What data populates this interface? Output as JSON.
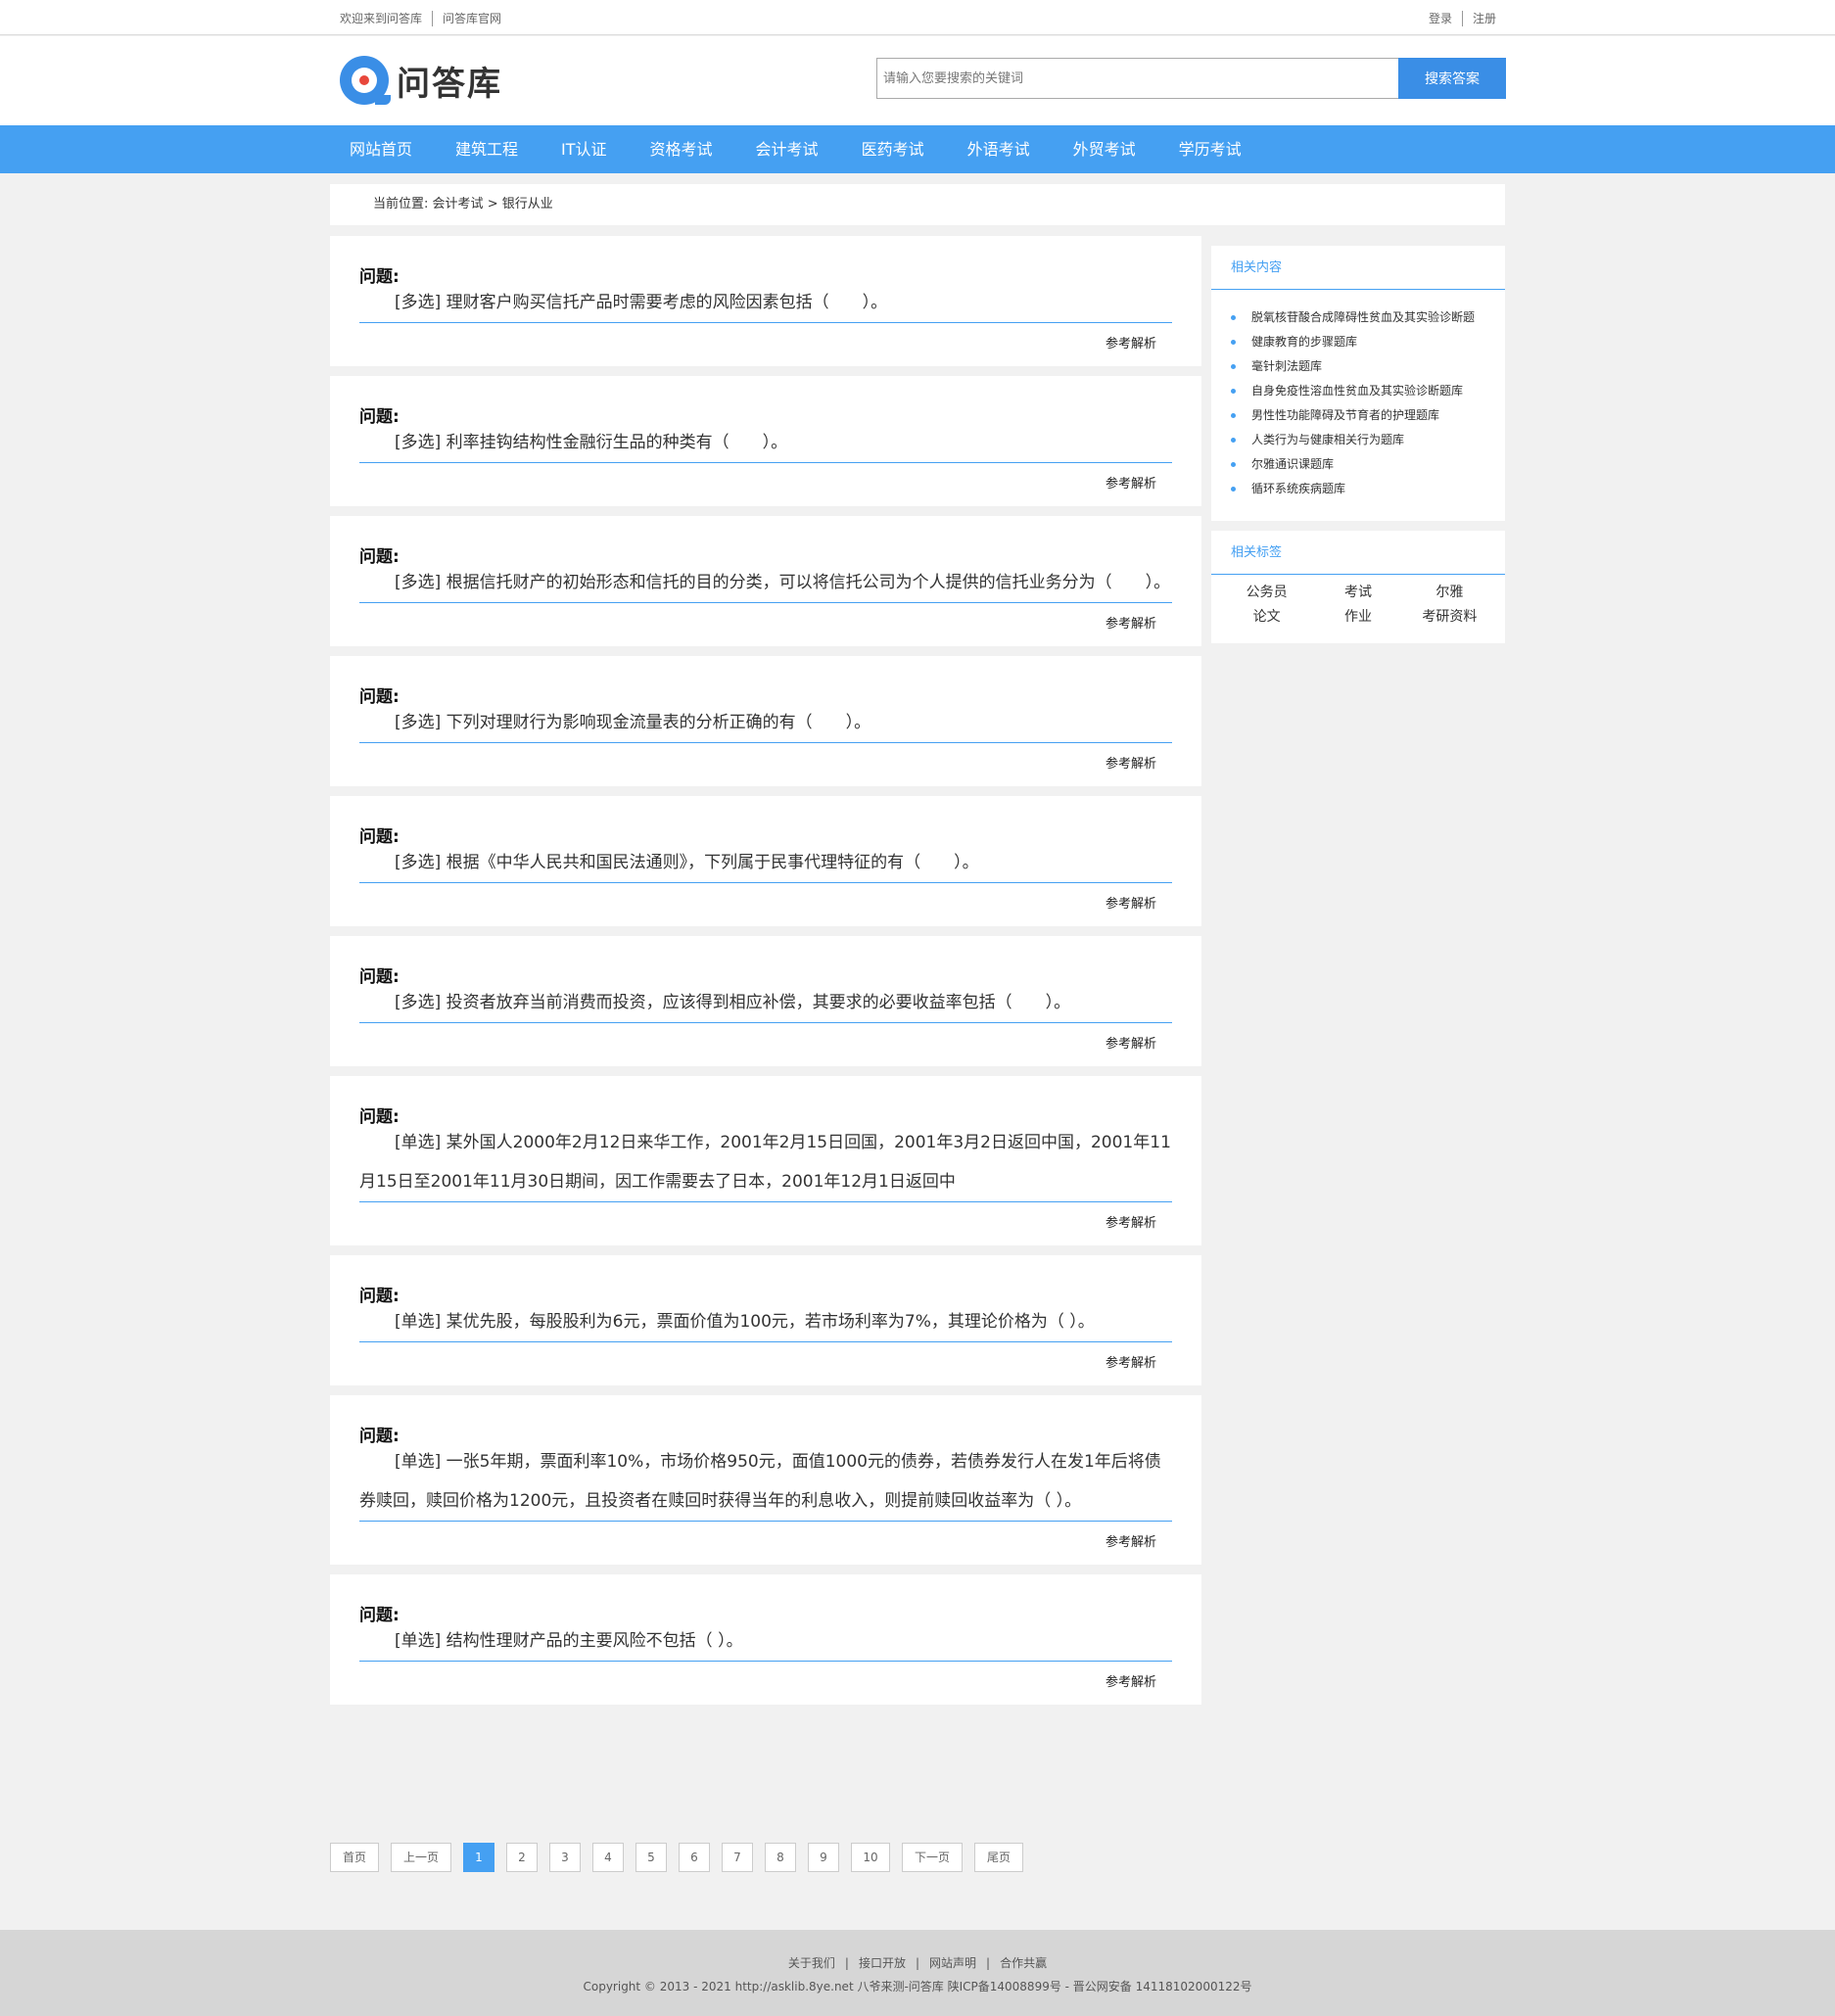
{
  "topbar": {
    "welcome": "欢迎来到问答库",
    "official": "问答库官网",
    "login": "登录",
    "register": "注册"
  },
  "header": {
    "logo_text": "问答库",
    "search_placeholder": "请输入您要搜索的关键词",
    "search_button": "搜索答案"
  },
  "nav": {
    "items": [
      "网站首页",
      "建筑工程",
      "IT认证",
      "资格考试",
      "会计考试",
      "医药考试",
      "外语考试",
      "外贸考试",
      "学历考试"
    ]
  },
  "breadcrumb": {
    "prefix": "当前位置:",
    "category": "会计考试",
    "separator": ">",
    "current": "银行从业"
  },
  "question_label": "问题:",
  "answer_link": "参考解析",
  "questions": [
    {
      "text": "[多选] 理财客户购买信托产品时需要考虑的风险因素包括（　　）。"
    },
    {
      "text": "[多选] 利率挂钩结构性金融衍生品的种类有（　　）。"
    },
    {
      "text": "[多选] 根据信托财产的初始形态和信托的目的分类，可以将信托公司为个人提供的信托业务分为（　　）。"
    },
    {
      "text": "[多选] 下列对理财行为影响现金流量表的分析正确的有（　　）。"
    },
    {
      "text": "[多选] 根据《中华人民共和国民法通则》，下列属于民事代理特征的有（　　）。"
    },
    {
      "text": "[多选] 投资者放弃当前消费而投资，应该得到相应补偿，其要求的必要收益率包括（　　）。"
    },
    {
      "text": "[单选] 某外国人2000年2月12日来华工作，2001年2月15日回国，2001年3月2日返回中国，2001年11月15日至2001年11月30日期间，因工作需要去了日本，2001年12月1日返回中"
    },
    {
      "text": "[单选] 某优先股，每股股利为6元，票面价值为100元，若市场利率为7%，其理论价格为（ ）。"
    },
    {
      "text": "[单选] 一张5年期，票面利率10%，市场价格950元，面值1000元的债券，若债券发行人在发1年后将债券赎回，赎回价格为1200元，且投资者在赎回时获得当年的利息收入，则提前赎回收益率为（ ）。"
    },
    {
      "text": "[单选] 结构性理财产品的主要风险不包括（ ）。"
    }
  ],
  "sidebar": {
    "related_title": "相关内容",
    "related_items": [
      "脱氧核苷酸合成障碍性贫血及其实验诊断题",
      "健康教育的步骤题库",
      "毫针刺法题库",
      "自身免疫性溶血性贫血及其实验诊断题库",
      "男性性功能障碍及节育者的护理题库",
      "人类行为与健康相关行为题库",
      "尔雅通识课题库",
      "循环系统疾病题库"
    ],
    "tags_title": "相关标签",
    "tags": [
      "公务员",
      "考试",
      "尔雅",
      "论文",
      "作业",
      "考研资料"
    ]
  },
  "pager": {
    "first": "首页",
    "prev": "上一页",
    "pages": [
      "1",
      "2",
      "3",
      "4",
      "5",
      "6",
      "7",
      "8",
      "9",
      "10"
    ],
    "current": "1",
    "next": "下一页",
    "last": "尾页"
  },
  "footer": {
    "links": [
      "关于我们",
      "接口开放",
      "网站声明",
      "合作共赢"
    ],
    "separator": "|",
    "copyright": "Copyright © 2013 - 2021 http://asklib.8ye.net  八爷来测-问答库   陕ICP备14008899号 - 晋公网安备 14118102000122号"
  }
}
